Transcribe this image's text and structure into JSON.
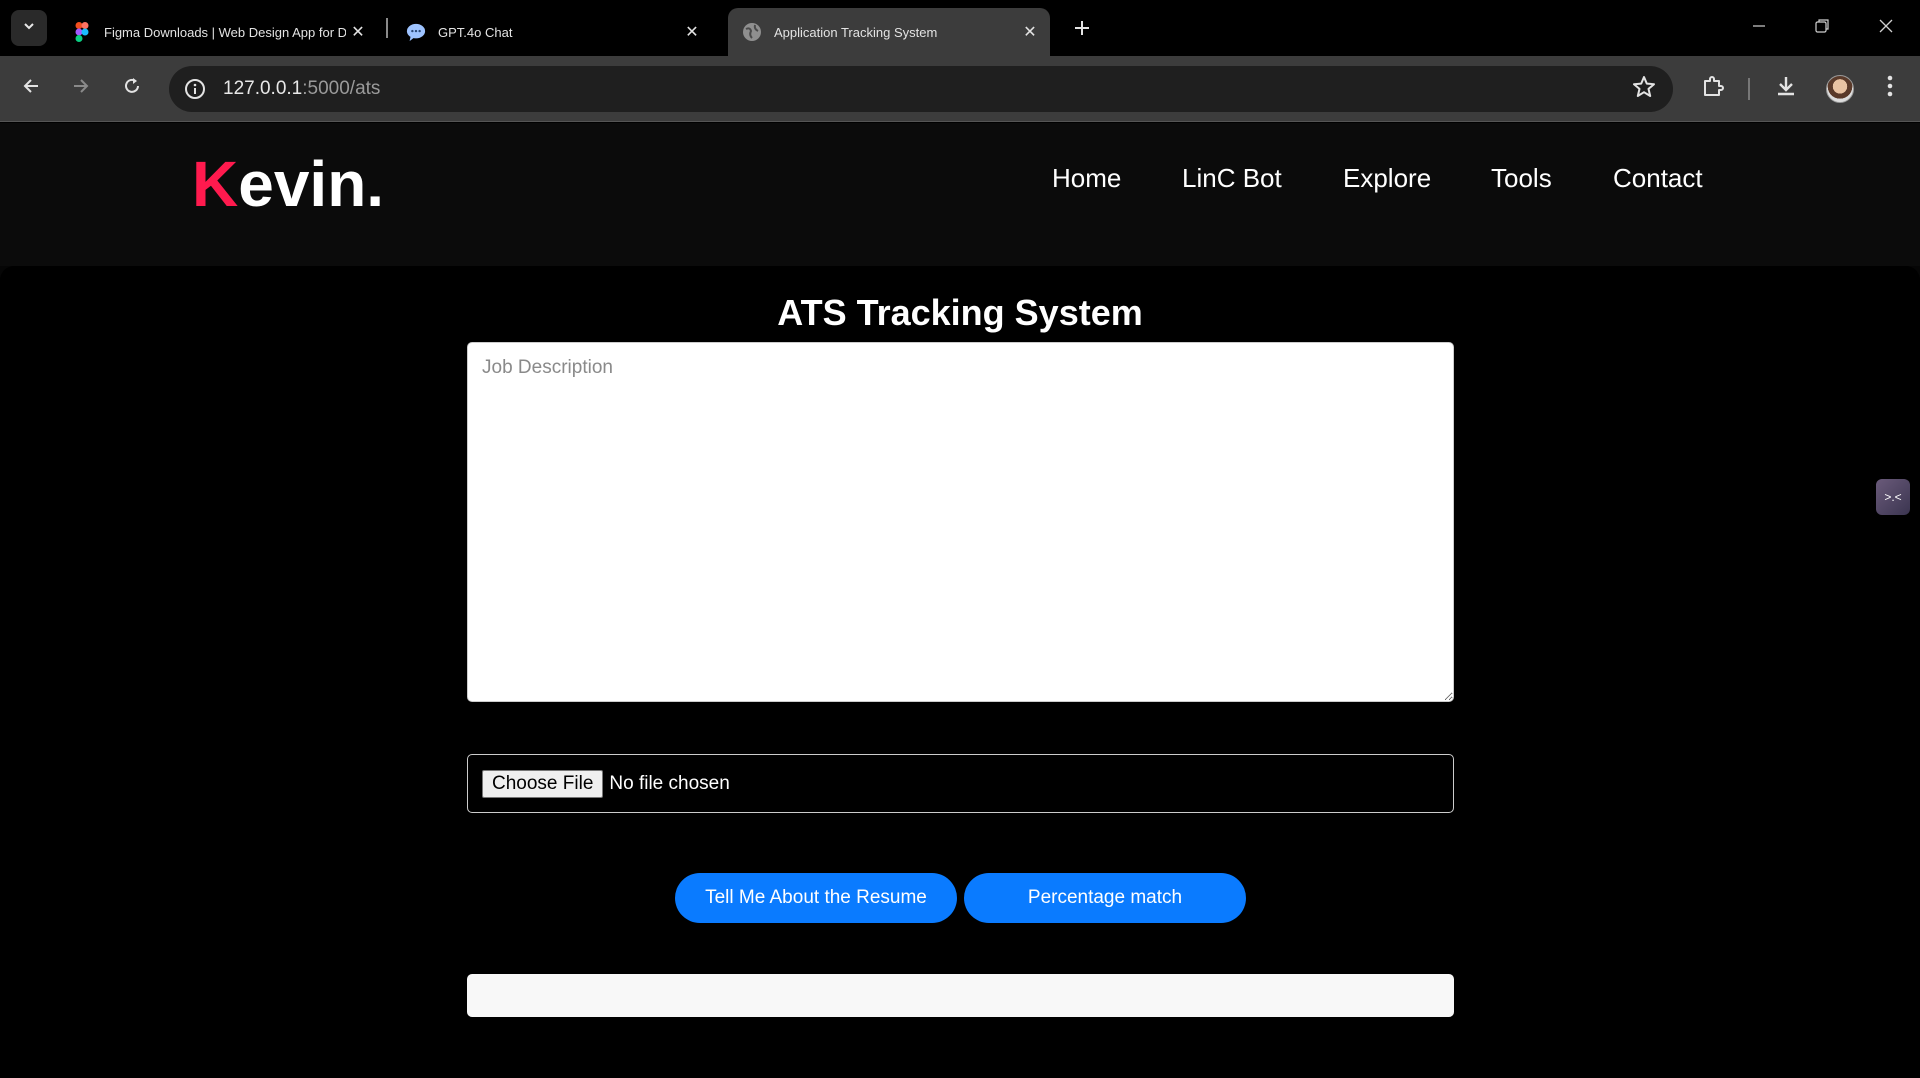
{
  "browser": {
    "tabs": [
      {
        "title": "Figma Downloads | Web Design App for D",
        "icon": "figma-icon",
        "active": false
      },
      {
        "title": "GPT.4o Chat",
        "icon": "chat-bubble-icon",
        "active": false
      },
      {
        "title": "Application Tracking System",
        "icon": "globe-icon",
        "active": true
      }
    ],
    "url_host": "127.0.0.1",
    "url_path": ":5000/ats"
  },
  "site": {
    "logo_first": "K",
    "logo_rest": "evin.",
    "nav": [
      "Home",
      "LinC Bot",
      "Explore",
      "Tools",
      "Contact"
    ]
  },
  "ats": {
    "title": "ATS Tracking System",
    "jd_placeholder": "Job Description",
    "choose_file": "Choose File",
    "no_file": "No file chosen",
    "btn_about": "Tell Me About the Resume",
    "btn_match": "Percentage match"
  },
  "colors": {
    "accent": "#ff1a4e",
    "button": "#0a7bff"
  }
}
